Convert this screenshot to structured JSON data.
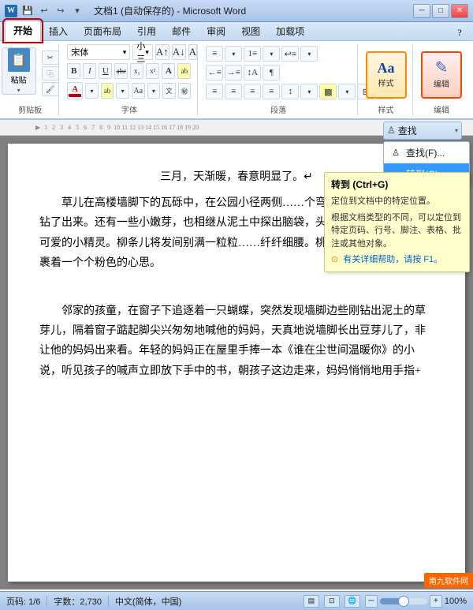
{
  "titlebar": {
    "title": "文档1 (自动保存的) - Microsoft Word",
    "icon": "W"
  },
  "quickaccess": {
    "buttons": [
      "💾",
      "↩",
      "↪",
      "▾"
    ]
  },
  "tabs": {
    "items": [
      "开始",
      "插入",
      "页面布局",
      "引用",
      "邮件",
      "审阅",
      "视图",
      "加载项"
    ],
    "active": "开始"
  },
  "ribbon": {
    "groups": {
      "clipboard": {
        "label": "剪贴板",
        "paste_label": "粘贴",
        "cut_label": "✂",
        "copy_label": "⿻",
        "format_label": "🖌"
      },
      "font": {
        "label": "字体",
        "name": "宋体",
        "size": "小三",
        "bold": "B",
        "italic": "I",
        "underline": "U",
        "strikethrough": "abc",
        "subscript": "x₁",
        "superscript": "x²"
      },
      "paragraph": {
        "label": "段落"
      },
      "styles": {
        "label": "样式",
        "icon_text": "Aa"
      },
      "editing": {
        "label": "编辑",
        "icon": "♪"
      }
    }
  },
  "find_replace_dropdown": {
    "label": "♙ 查找▾",
    "items": [
      {
        "label": "查找(F)...",
        "icon": "♙",
        "active": false
      },
      {
        "label": "转到(G)...",
        "icon": "→",
        "active": true
      }
    ]
  },
  "tooltip": {
    "title": "转到 (Ctrl+G)",
    "desc1": "定位到文档中的特定位置。",
    "desc2": "根据文档类型的不同，可以定位到特定页码、行号、脚注、表格、批注或其他对象。",
    "help": "有关详细帮助，请按 F1。"
  },
  "document": {
    "paragraphs": [
      "三月，天渐暖，春意明显了。↵",
      "草儿在高楼墙脚下的瓦砾中，在公园小径两侧……一个弯，转几个折，欣幸地钻了出来。还有一些小嫩芽，也相继从泥土中探出脑袋，头上还顶着籽粒……皮可爱的小精灵。柳条儿将发间别满一粒粒……纤纤细腰。桃枝上稠密的花蕾，包裹着一个个粉色的心思。",
      "邻家的孩童，在窗子下追逐着一只蝴蝶，突然发现墙脚边些刚钻出泥土的草芽儿，隔着窗子踮起脚尖兴匆匆地喊他的妈妈，天真地说墙脚长出豆芽儿了，非让他的妈妈出来看。年轻的妈妈正在屋里手捧一本《谁在尘世间温暖你》的小说，听见孩子的喊声立即放下手中的书，朝孩子这边走来，妈妈悄悄地用手指+"
    ]
  },
  "statusbar": {
    "page": "页码: 1/6",
    "words": "字数：2,730",
    "lang": "中文(简体，中国)",
    "zoom": "100%"
  }
}
